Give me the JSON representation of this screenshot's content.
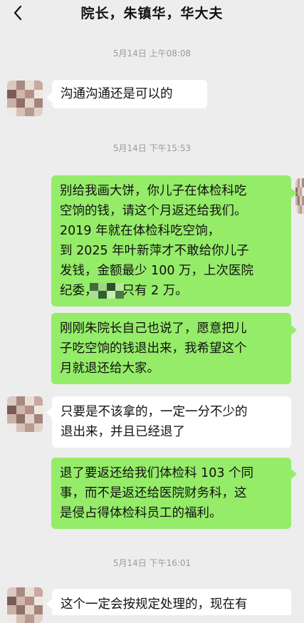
{
  "header": {
    "back_icon": "chevron-left-icon",
    "title": "院长，朱镇华，华大夫"
  },
  "timestamps": [
    "5月14日 上午08:08",
    "5月14日 下午15:53",
    "5月14日 下午16:01"
  ],
  "messages": [
    {
      "side": "left",
      "lines": [
        "沟通沟通还是可以的"
      ]
    },
    {
      "side": "right",
      "lines": [
        "别给我画大饼，你儿子在体检科吃",
        "空饷的钱，请这个月返还给我们。",
        "2019 年就在体检科吃空饷，",
        "到 2025 年叶新萍才不敢给你儿子",
        "发钱，金额最少 100 万，上次医院",
        "纪委，诉辩只有 2 万。"
      ]
    },
    {
      "side": "right",
      "lines": [
        "刚刚朱院长自己也说了，愿意把儿",
        "子吃空饷的钱退出来，我希望这个",
        "月就退还给大家。"
      ]
    },
    {
      "side": "left",
      "lines": [
        "只要是不该拿的，一定一分不少的",
        "退出来，并且已经退了"
      ]
    },
    {
      "side": "right",
      "lines": [
        "退了要返还给我们体检科 103 个同",
        "事，而不是返还给医院财务科，这",
        "是侵占得体检科员工的福利。"
      ]
    },
    {
      "side": "left",
      "lines": [
        "这个一定会按规定处理的，现在有"
      ]
    }
  ],
  "colors": {
    "background": "#ededed",
    "incoming_bubble": "#ffffff",
    "outgoing_bubble": "#95ec69",
    "timestamp_text": "#9b9b9b"
  }
}
